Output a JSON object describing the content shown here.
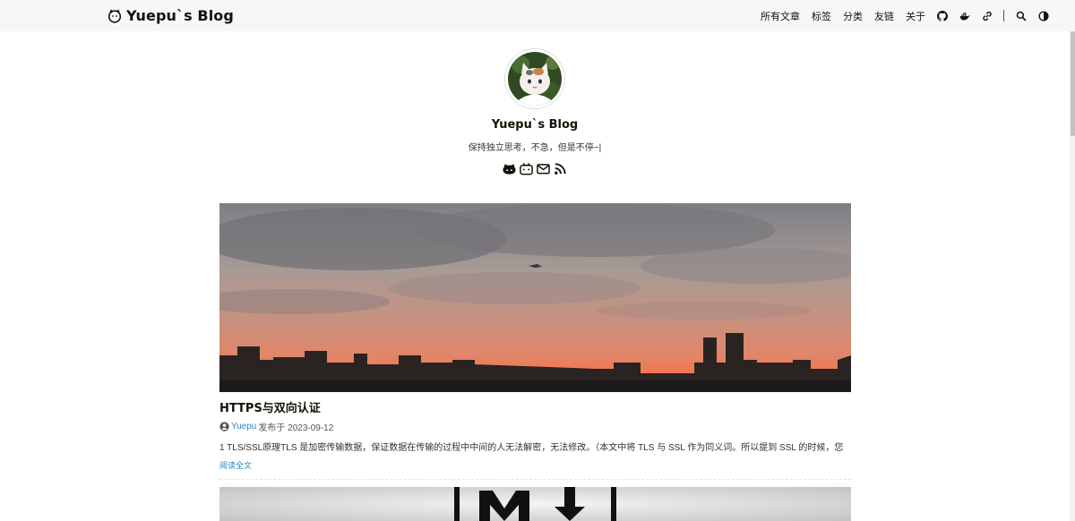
{
  "header": {
    "brand": "Yuepu`s Blog",
    "nav": [
      {
        "label": "所有文章",
        "name": "nav-all-posts"
      },
      {
        "label": "标签",
        "name": "nav-tags"
      },
      {
        "label": "分类",
        "name": "nav-categories"
      },
      {
        "label": "友链",
        "name": "nav-friend-links"
      },
      {
        "label": "关于",
        "name": "nav-about"
      }
    ],
    "icons": [
      "github-icon",
      "docker-icon",
      "link-icon",
      "search-icon",
      "theme-toggle-icon"
    ]
  },
  "profile": {
    "name": "Yuepu`s Blog",
    "description": "保持独立思考，不急，但是不停~|",
    "social_icons": [
      "github-icon",
      "bilibili-icon",
      "email-icon",
      "rss-icon"
    ]
  },
  "posts": [
    {
      "title": "HTTPS与双向认证",
      "author": "Yuepu",
      "published": "发布于 2023-09-12",
      "summary": "1 TLS/SSL原理TLS 是加密传输数据，保证数据在传输的过程中中间的人无法解密，无法修改。（本文中将 TLS 与 SSL 作为同义词。所以提到 SSL 的时候，您",
      "read_more": "阅读全文"
    }
  ],
  "colors": {
    "header_bg": "#f7f7f7",
    "link": "#2e86c1",
    "text": "#161209"
  }
}
